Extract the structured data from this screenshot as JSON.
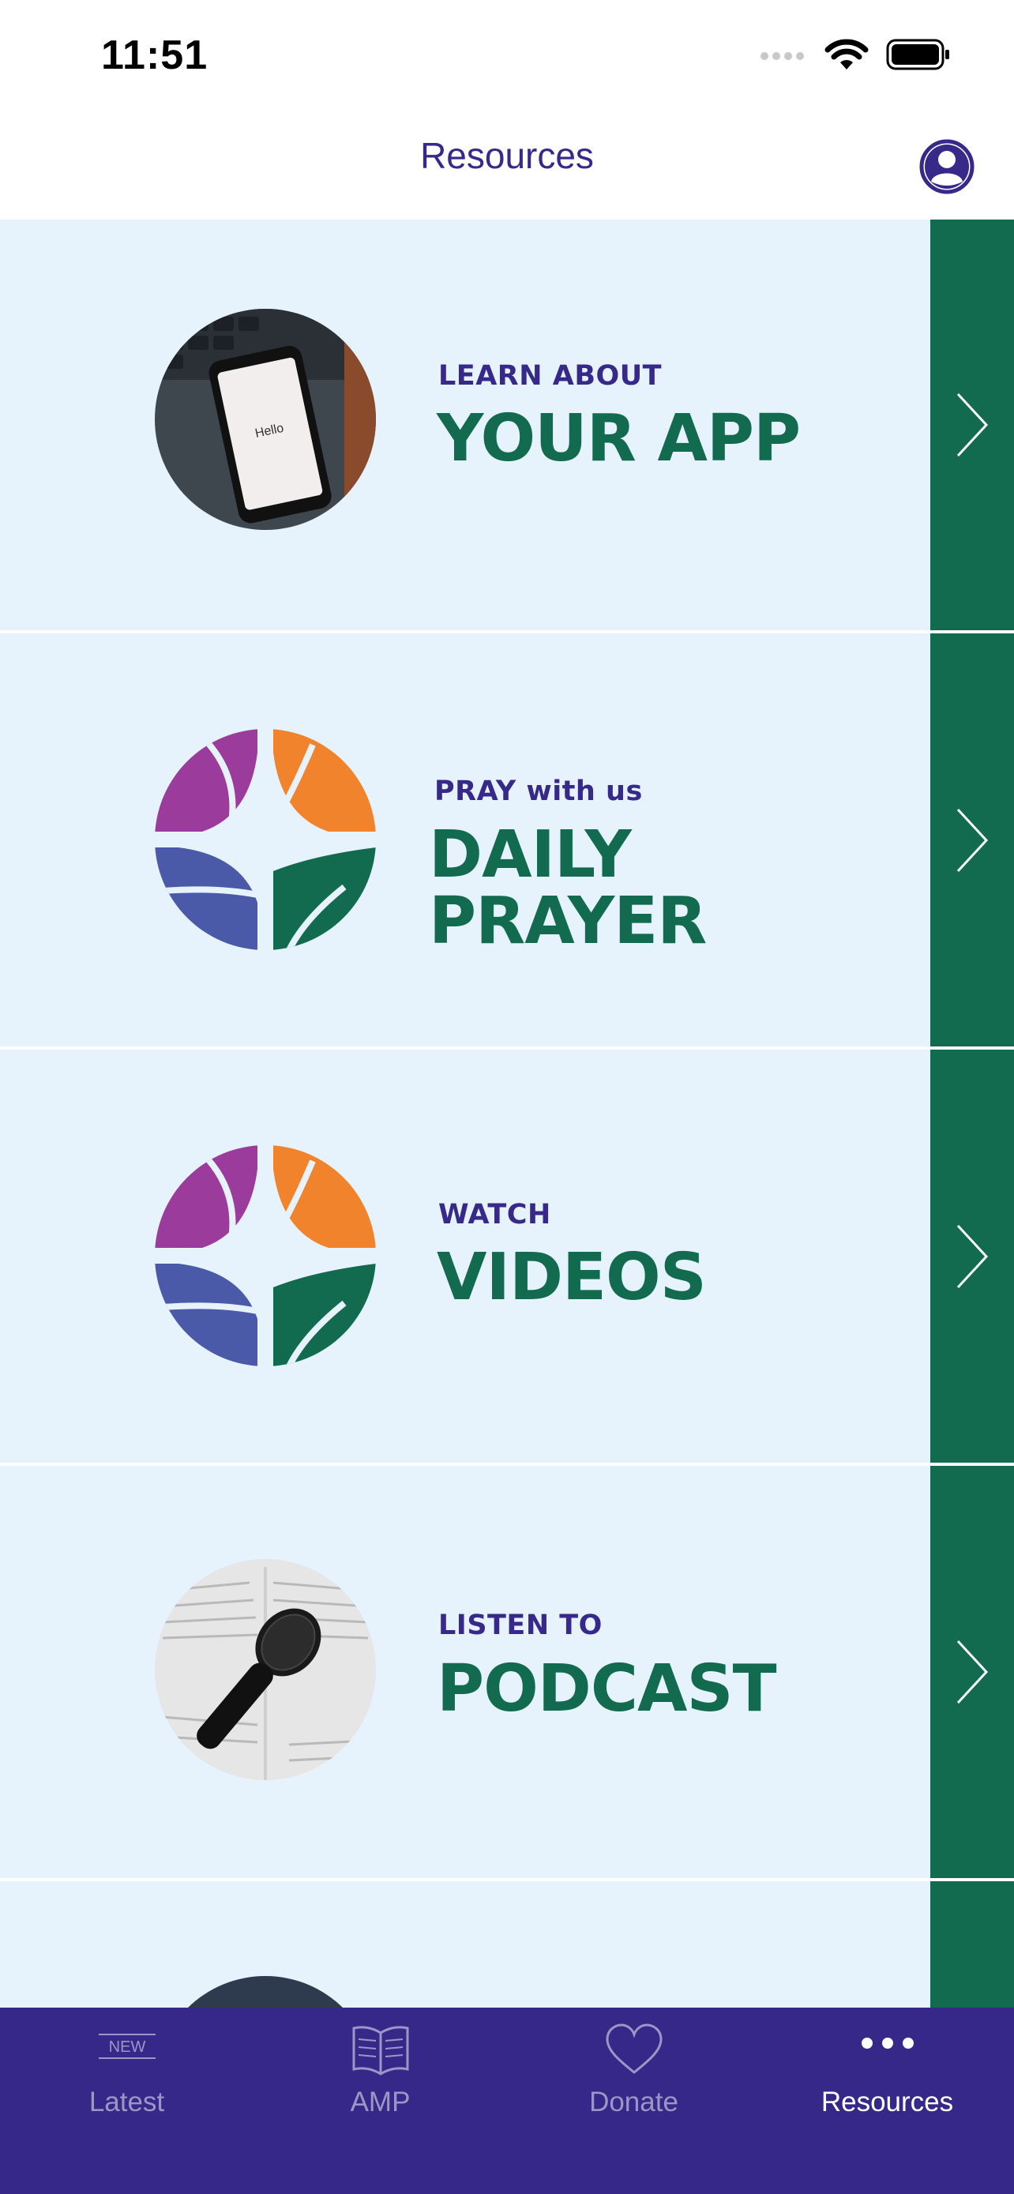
{
  "status_bar": {
    "time": "11:51"
  },
  "header": {
    "title": "Resources"
  },
  "rows": [
    {
      "pre": "LEARN ABOUT",
      "title_line1": "YOUR APP",
      "title_line2": ""
    },
    {
      "pre": "PRAY with us",
      "title_line1": "DAILY",
      "title_line2": "PRAYER"
    },
    {
      "pre": "WATCH",
      "title_line1": "VIDEOS",
      "title_line2": ""
    },
    {
      "pre": "LISTEN TO",
      "title_line1": "PODCAST",
      "title_line2": ""
    }
  ],
  "thumbs": {
    "phone_screen_text": "Hello"
  },
  "tabbar": {
    "latest_badge": "NEW",
    "latest": "Latest",
    "amp": "AMP",
    "donate": "Donate",
    "resources": "Resources"
  },
  "colors": {
    "accent_purple": "#36298a",
    "accent_green": "#126b4e",
    "row_bg": "#e7f3fc",
    "tab_bg": "#352888"
  }
}
